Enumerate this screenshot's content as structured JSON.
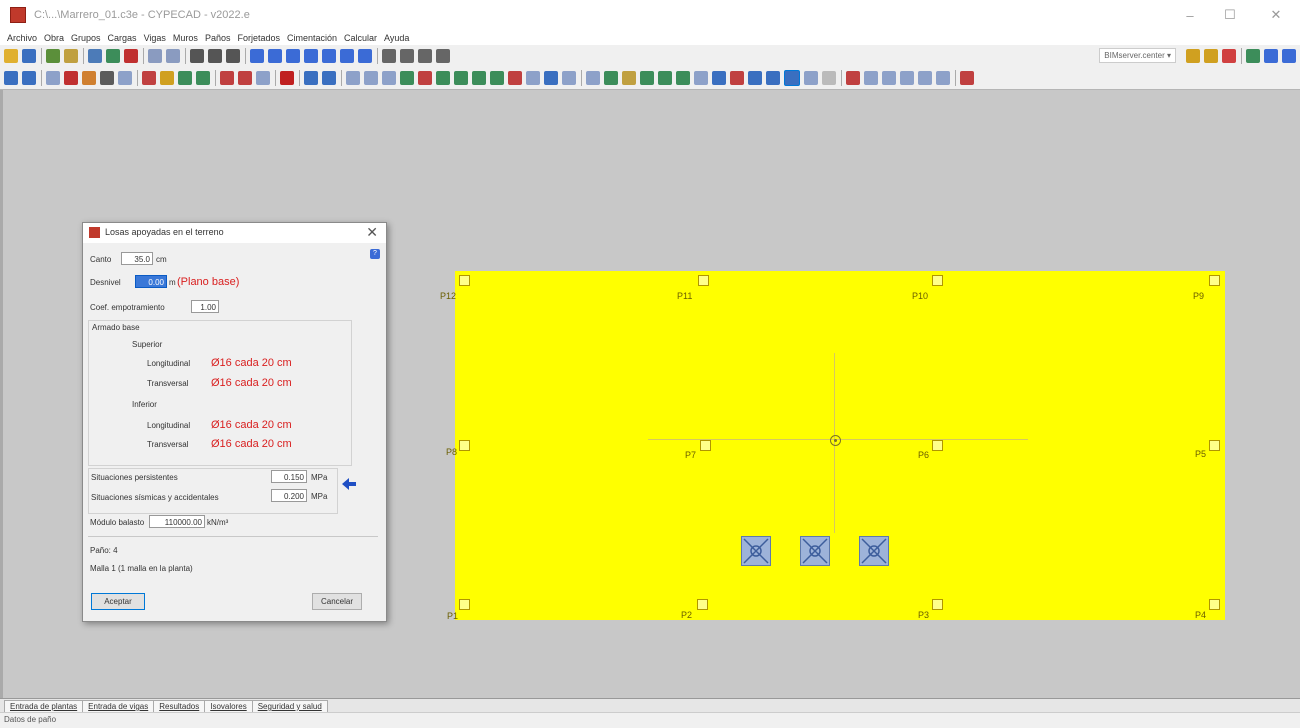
{
  "window": {
    "title": "C:\\...\\Marrero_01.c3e - CYPECAD - v2022.e"
  },
  "menu": [
    "Archivo",
    "Obra",
    "Grupos",
    "Cargas",
    "Vigas",
    "Muros",
    "Paños",
    "Forjetados",
    "Cimentación",
    "Calcular",
    "Ayuda"
  ],
  "toolbar": {
    "layer_combo": "BIMserver.center ▾"
  },
  "columns": [
    {
      "id": "P12",
      "label": "P12"
    },
    {
      "id": "P11",
      "label": "P11"
    },
    {
      "id": "P10",
      "label": "P10"
    },
    {
      "id": "P9",
      "label": "P9"
    },
    {
      "id": "P8",
      "label": "P8"
    },
    {
      "id": "P7",
      "label": "P7"
    },
    {
      "id": "P6",
      "label": "P6"
    },
    {
      "id": "P5",
      "label": "P5"
    },
    {
      "id": "P1",
      "label": "P1"
    },
    {
      "id": "P2",
      "label": "P2"
    },
    {
      "id": "P3",
      "label": "P3"
    },
    {
      "id": "P4",
      "label": "P4"
    }
  ],
  "dialog": {
    "title": "Losas apoyadas en el terreno",
    "canto_label": "Canto",
    "canto_value": "35.0",
    "canto_unit": "cm",
    "desnivel_label": "Desnivel",
    "desnivel_value": "0.00",
    "desnivel_unit": "m",
    "desnivel_note": "(Plano base)",
    "coef_label": "Coef. empotramiento",
    "coef_value": "1.00",
    "armado_label": "Armado base",
    "superior_label": "Superior",
    "sup_long_label": "Longitudinal",
    "sup_long_value": "Ø16 cada 20 cm",
    "sup_trans_label": "Transversal",
    "sup_trans_value": "Ø16 cada 20 cm",
    "inferior_label": "Inferior",
    "inf_long_label": "Longitudinal",
    "inf_long_value": "Ø16 cada 20 cm",
    "inf_trans_label": "Transversal",
    "inf_trans_value": "Ø16 cada 20 cm",
    "sit_pers_label": "Situaciones persistentes",
    "sit_pers_value": "0.150",
    "sit_pers_unit": "MPa",
    "sit_sism_label": "Situaciones sísmicas y accidentales",
    "sit_sism_value": "0.200",
    "sit_sism_unit": "MPa",
    "modulo_label": "Módulo balasto",
    "modulo_value": "110000.00",
    "modulo_unit": "kN/m³",
    "pano_label": "Paño: 4",
    "malla_label": "Malla 1 (1 malla en la planta)",
    "accept_label": "Aceptar",
    "cancel_label": "Cancelar"
  },
  "tabs": [
    "Entrada de plantas",
    "Entrada de vigas",
    "Resultados",
    "Isovalores",
    "Seguridad y salud"
  ],
  "status": "Datos de paño"
}
